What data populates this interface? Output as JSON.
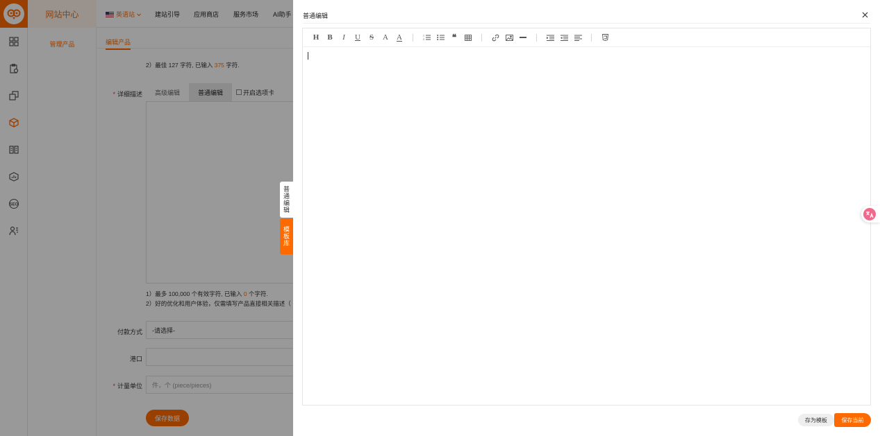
{
  "topnav": {
    "site_title": "网站中心",
    "lang_label": "英语站",
    "items": [
      "建站引导",
      "应用商店",
      "服务市场",
      "AI助手"
    ]
  },
  "subside": {
    "item": "管理产品"
  },
  "main": {
    "tab_label": "编辑产品",
    "hint_top_2_prefix": "2）最佳 127 字符, 已输入 ",
    "hint_top_2_count": "375",
    "hint_top_2_suffix": " 字符.",
    "detail_label": "详细描述",
    "editor_tabs": [
      "高级编辑",
      "普通编辑"
    ],
    "tab_checkbox": "开启选项卡",
    "hint_bottom_1_prefix": "1）最多 100,000 个有效字符, 已输入 ",
    "hint_bottom_1_count": "0",
    "hint_bottom_1_suffix": " 个字符.",
    "hint_bottom_2": "2）好的优化和用户体验，仅需填写产品直接相关描述（",
    "payment_label": "付款方式",
    "payment_value": "-请选择-",
    "port_label": "港口",
    "unit_label": "计量单位",
    "unit_placeholder": "件，个 (piece/pieces)",
    "save_label": "保存数据"
  },
  "sidetabs": {
    "normal": "普通编辑",
    "library": "模板库"
  },
  "drawer": {
    "title": "普通编辑",
    "save_template": "存为模板",
    "save_current": "保存当前"
  },
  "toolbar": {
    "groups": [
      [
        "heading-icon",
        "bold-icon",
        "italic-icon",
        "underline-icon",
        "strikethrough-icon",
        "font-color-icon",
        "background-color-icon"
      ],
      [
        "ordered-list-icon",
        "bullet-list-icon",
        "quote-icon",
        "table-icon"
      ],
      [
        "link-icon",
        "image-icon",
        "horizontal-rule-icon"
      ],
      [
        "indent-icon",
        "outdent-icon",
        "align-icon"
      ],
      [
        "html-source-icon"
      ]
    ]
  },
  "colors": {
    "accent": "#ff6a00",
    "mask": "rgba(0,0,0,0.4)",
    "bubble": "#f06a8d"
  },
  "rail_icons": [
    "dashboard-icon",
    "clipboard-icon",
    "copy-icon",
    "product-box-icon",
    "book-icon",
    "analytics-icon",
    "seo-icon",
    "users-icon"
  ]
}
